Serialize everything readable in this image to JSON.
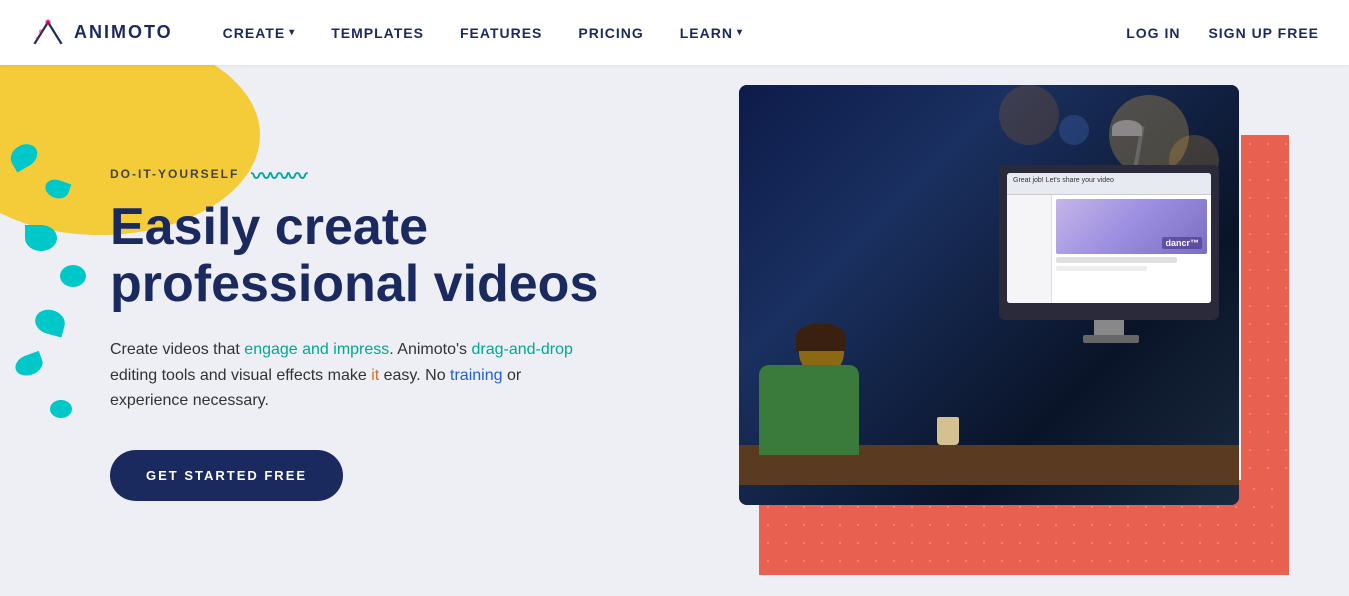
{
  "brand": {
    "name": "ANIMOTO",
    "logo_alt": "Animoto logo"
  },
  "navbar": {
    "create_label": "CREATE",
    "templates_label": "TEMPLATES",
    "features_label": "FEATURES",
    "pricing_label": "PRICING",
    "learn_label": "LEARN",
    "login_label": "LOG IN",
    "signup_label": "SIGN UP FREE"
  },
  "hero": {
    "label": "DO-IT-YOURSELF",
    "title_line1": "Easily create",
    "title_line2": "professional videos",
    "desc_part1": "Create videos that ",
    "desc_highlight1": "engage and impress",
    "desc_part2": ". Animoto's ",
    "desc_highlight2": "drag-and-drop",
    "desc_part3": "\nediting tools and visual effects make ",
    "desc_highlight3": "it",
    "desc_part4": " easy. No training or\nexperience necessary.",
    "cta_label": "GET STARTED FREE"
  },
  "screen": {
    "dancr_label": "dancr™"
  }
}
